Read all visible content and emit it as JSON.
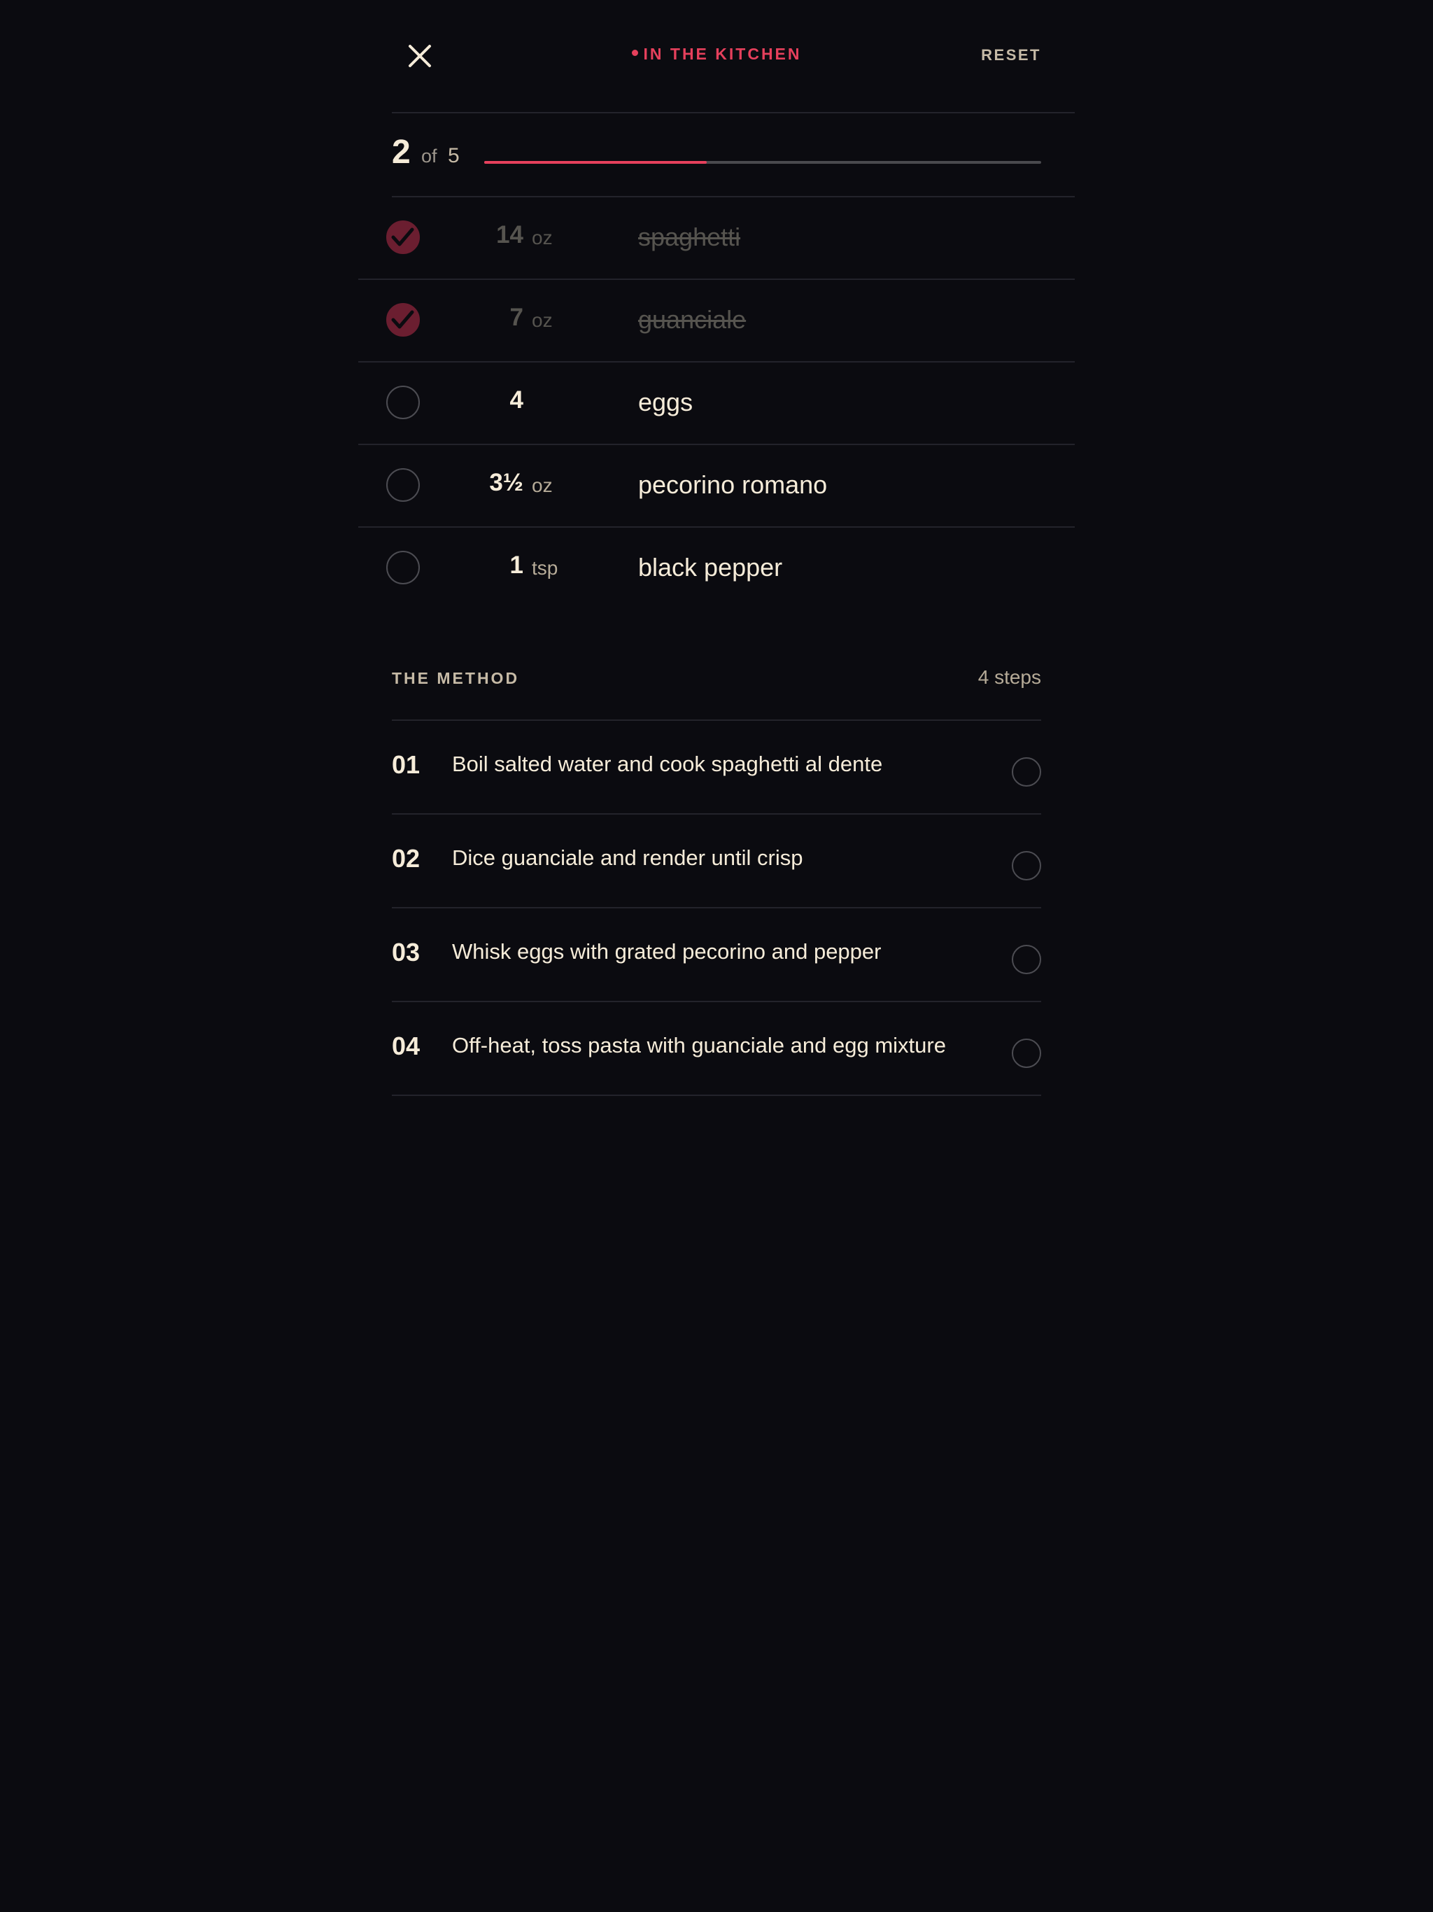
{
  "header": {
    "status_label": "IN THE KITCHEN",
    "reset_label": "RESET"
  },
  "progress": {
    "current": "2",
    "of_label": "of",
    "total": "5",
    "fraction": 0.4
  },
  "ingredients": [
    {
      "qty": "14",
      "unit": "oz",
      "name": "spaghetti",
      "checked": true
    },
    {
      "qty": "7",
      "unit": "oz",
      "name": "guanciale",
      "checked": true
    },
    {
      "qty": "4",
      "unit": "",
      "name": "eggs",
      "checked": false
    },
    {
      "qty": "3½",
      "unit": "oz",
      "name": "pecorino romano",
      "checked": false
    },
    {
      "qty": "1",
      "unit": "tsp",
      "name": "black pepper",
      "checked": false
    }
  ],
  "method": {
    "title": "THE METHOD",
    "count_label": "4 steps",
    "steps": [
      {
        "num": "01",
        "text": "Boil salted water and cook spaghetti al dente",
        "checked": false
      },
      {
        "num": "02",
        "text": "Dice guanciale and render until crisp",
        "checked": false
      },
      {
        "num": "03",
        "text": "Whisk eggs with grated pecorino and pepper",
        "checked": false
      },
      {
        "num": "04",
        "text": "Off-heat, toss pasta with guanciale and egg mixture",
        "checked": false
      }
    ]
  },
  "colors": {
    "background": "#0b0b10",
    "accent": "#e6405c",
    "checked_fill": "#6b1e30",
    "text": "#f6ecd9"
  }
}
